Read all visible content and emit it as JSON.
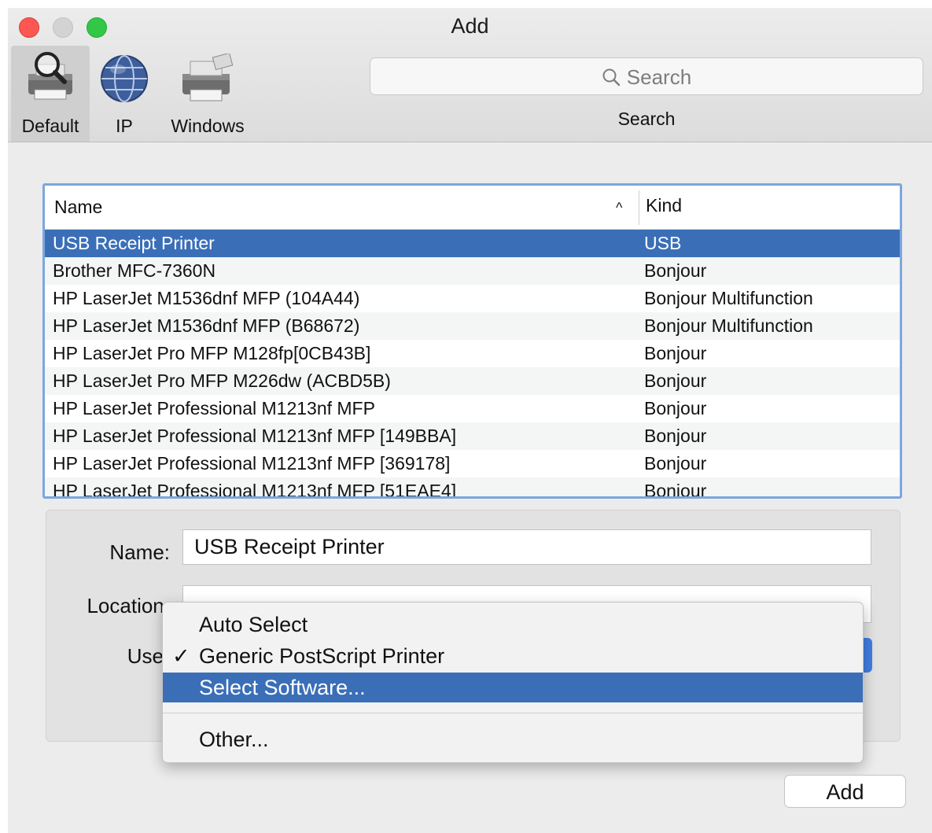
{
  "window": {
    "title": "Add"
  },
  "toolbar": {
    "tabs": [
      {
        "label": "Default"
      },
      {
        "label": "IP"
      },
      {
        "label": "Windows"
      }
    ],
    "search_placeholder": "Search",
    "search_label": "Search"
  },
  "printer_list": {
    "columns": {
      "name": "Name",
      "kind": "Kind"
    },
    "rows": [
      {
        "name": "USB Receipt Printer",
        "kind": "USB"
      },
      {
        "name": "Brother MFC-7360N",
        "kind": "Bonjour"
      },
      {
        "name": "HP LaserJet M1536dnf MFP (104A44)",
        "kind": "Bonjour Multifunction"
      },
      {
        "name": "HP LaserJet M1536dnf MFP (B68672)",
        "kind": "Bonjour Multifunction"
      },
      {
        "name": "HP LaserJet Pro MFP M128fp[0CB43B]",
        "kind": "Bonjour"
      },
      {
        "name": "HP LaserJet Pro MFP M226dw (ACBD5B)",
        "kind": "Bonjour"
      },
      {
        "name": "HP LaserJet Professional M1213nf MFP",
        "kind": "Bonjour"
      },
      {
        "name": "HP LaserJet Professional M1213nf MFP [149BBA]",
        "kind": "Bonjour"
      },
      {
        "name": "HP LaserJet Professional M1213nf MFP [369178]",
        "kind": "Bonjour"
      },
      {
        "name": "HP LaserJet Professional M1213nf MFP [51EAE4]",
        "kind": "Bonjour"
      }
    ]
  },
  "details": {
    "name_label": "Name:",
    "name_value": "USB Receipt Printer",
    "location_label": "Location:",
    "use_label": "Use"
  },
  "use_menu": {
    "items": [
      {
        "label": "Auto Select"
      },
      {
        "label": "Generic PostScript Printer",
        "checked": true
      },
      {
        "label": "Select Software..."
      },
      {
        "label": "Other..."
      }
    ],
    "check_glyph": "✓"
  },
  "footer": {
    "add_label": "Add"
  }
}
